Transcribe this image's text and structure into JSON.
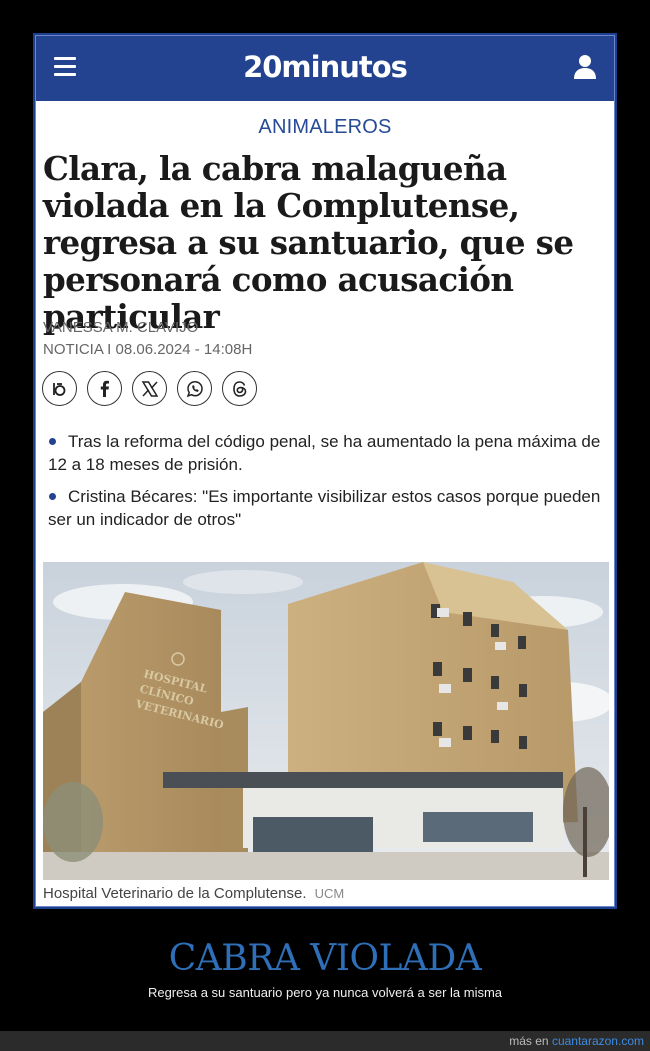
{
  "header": {
    "logo": "20minutos",
    "menu_icon": "hamburger-menu-icon",
    "user_icon": "user-icon",
    "bg_color": "#23428f"
  },
  "article": {
    "section": "ANIMALEROS",
    "headline": "Clara, la cabra malagueña violada en la Complutense, regresa a su santuario, que se personará como acusación particular",
    "author": "Vanessa M. Clavijo",
    "meta": "NOTICIA  I 08.06.2024 - 14:08h",
    "share": [
      {
        "icon": "bluesky-share-icon"
      },
      {
        "icon": "facebook-share-icon"
      },
      {
        "icon": "x-share-icon"
      },
      {
        "icon": "whatsapp-share-icon"
      },
      {
        "icon": "threads-share-icon"
      }
    ],
    "bullets": [
      "Tras la reforma del código penal, se ha aumentado la pena máxima de 12 a 18 meses de prisión.",
      "Cristina Bécares: \"Es importante visibilizar estos casos porque pueden ser un indicador de otros\""
    ],
    "image": {
      "building_sign": "HOSPITAL CLÍNICO VETERINARIO",
      "caption": "Hospital Veterinario de la Complutense.",
      "credit": "UCM"
    }
  },
  "meme": {
    "title": "CABRA VIOLADA",
    "subtitle": "Regresa a su santuario pero ya nunca volverá a ser la misma",
    "footer_prefix": "más en",
    "footer_link": "cuantarazon.com"
  }
}
